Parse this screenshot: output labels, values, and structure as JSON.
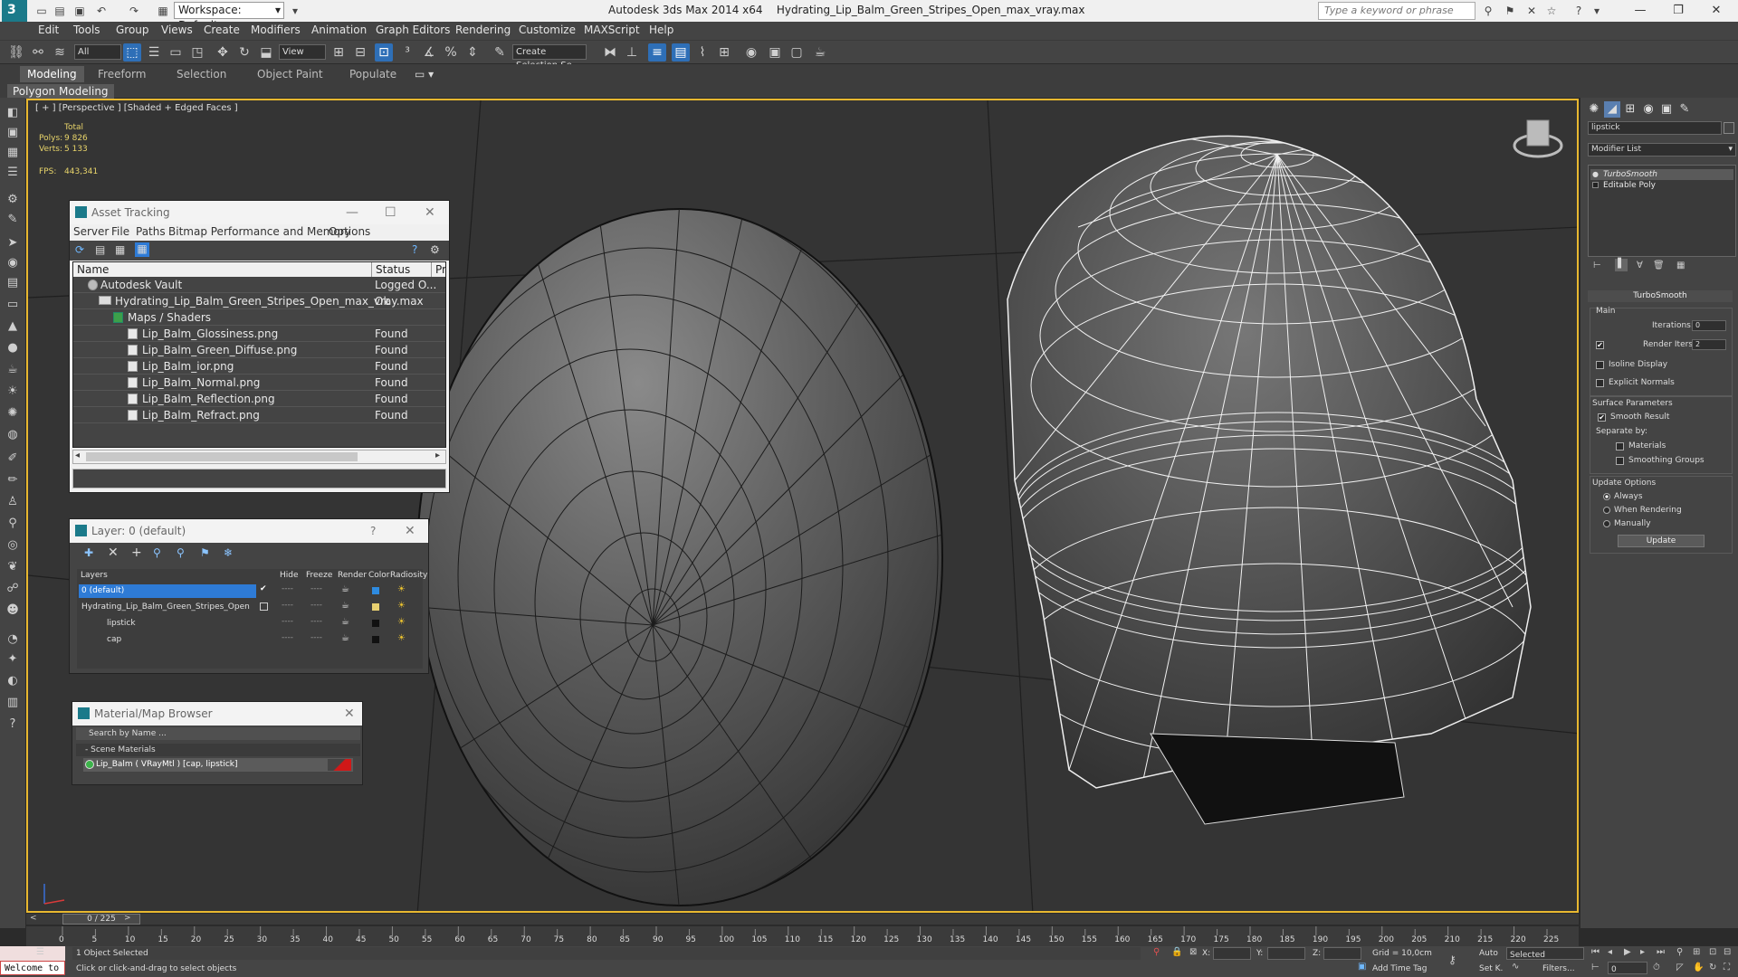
{
  "titlebar": {
    "workspace": "Workspace: Default",
    "app_title": "Autodesk 3ds Max  2014 x64",
    "file_title": "Hydrating_Lip_Balm_Green_Stripes_Open_max_vray.max",
    "search_placeholder": "Type a keyword or phrase"
  },
  "menu": [
    "Edit",
    "Tools",
    "Group",
    "Views",
    "Create",
    "Modifiers",
    "Animation",
    "Graph Editors",
    "Rendering",
    "Customize",
    "MAXScript",
    "Help"
  ],
  "toolbar": {
    "filter_value": "All",
    "refcoord_value": "View",
    "selection_set_placeholder": "Create Selection Se"
  },
  "ribbon": {
    "tabs": [
      "Modeling",
      "Freeform",
      "Selection",
      "Object Paint",
      "Populate"
    ],
    "active_tab": "Modeling",
    "panel_label": "Polygon Modeling"
  },
  "viewport": {
    "label": "[ + ] [Perspective ] [Shaded + Edged Faces ]",
    "stats_total": "Total",
    "stats_polys_label": "Polys:",
    "stats_polys": "9 826",
    "stats_verts_label": "Verts:",
    "stats_verts": "5 133",
    "fps_label": "FPS:",
    "fps": "443,341"
  },
  "asset_tracking": {
    "title": "Asset Tracking",
    "menu": [
      "Server",
      "File",
      "Paths",
      "Bitmap Performance and Memory",
      "Options"
    ],
    "col_name": "Name",
    "col_status": "Status",
    "col_pro": "Pro",
    "rows": [
      {
        "name": "Autodesk Vault",
        "status": "Logged O..."
      },
      {
        "name": "Hydrating_Lip_Balm_Green_Stripes_Open_max_vray.max",
        "status": "Ok"
      },
      {
        "name": "Maps / Shaders",
        "status": ""
      },
      {
        "name": "Lip_Balm_Glossiness.png",
        "status": "Found"
      },
      {
        "name": "Lip_Balm_Green_Diffuse.png",
        "status": "Found"
      },
      {
        "name": "Lip_Balm_ior.png",
        "status": "Found"
      },
      {
        "name": "Lip_Balm_Normal.png",
        "status": "Found"
      },
      {
        "name": "Lip_Balm_Reflection.png",
        "status": "Found"
      },
      {
        "name": "Lip_Balm_Refract.png",
        "status": "Found"
      }
    ]
  },
  "layer_explorer": {
    "title": "Layer: 0 (default)",
    "help": "?",
    "headers": [
      "Layers",
      "Hide",
      "Freeze",
      "Render",
      "Color",
      "Radiosity"
    ],
    "rows": [
      {
        "name": "0 (default)",
        "color": "#2e8be0"
      },
      {
        "name": "Hydrating_Lip_Balm_Green_Stripes_Open",
        "color": "#e8d070"
      },
      {
        "name": "lipstick",
        "color": "#111111"
      },
      {
        "name": "cap",
        "color": "#111111"
      }
    ],
    "dash": "----"
  },
  "material_browser": {
    "title": "Material/Map Browser",
    "search_placeholder": "Search by Name ...",
    "category": "- Scene Materials",
    "item": "Lip_Balm  ( VRayMtl ) [cap, lipstick]"
  },
  "command_panel": {
    "object_name": "lipstick",
    "modifier_list": "Modifier List",
    "stack": [
      "TurboSmooth",
      "Editable Poly"
    ],
    "rollout_title": "TurboSmooth",
    "main_label": "Main",
    "iterations_label": "Iterations:",
    "iterations_value": "0",
    "render_iters_label": "Render Iters:",
    "render_iters_value": "2",
    "isoline_label": "Isoline Display",
    "explicit_normals_label": "Explicit Normals",
    "surface_params_label": "Surface Parameters",
    "smooth_result_label": "Smooth Result",
    "separate_by_label": "Separate by:",
    "materials_label": "Materials",
    "smoothing_groups_label": "Smoothing Groups",
    "update_options_label": "Update Options",
    "always_label": "Always",
    "when_rendering_label": "When Rendering",
    "manually_label": "Manually",
    "update_button": "Update"
  },
  "timeline": {
    "frame_display": "0 / 225",
    "ticks": [
      "0",
      "5",
      "10",
      "15",
      "20",
      "25",
      "30",
      "35",
      "40",
      "45",
      "50",
      "55",
      "60",
      "65",
      "70",
      "75",
      "80",
      "85",
      "90",
      "95",
      "100",
      "105",
      "110",
      "115",
      "120",
      "125",
      "130",
      "135",
      "140",
      "145",
      "150",
      "155",
      "160",
      "165",
      "170",
      "175",
      "180",
      "185",
      "190",
      "195",
      "200",
      "205",
      "210",
      "215",
      "220",
      "225"
    ]
  },
  "statusbar": {
    "maxscript": "Welcome to",
    "selection_status": "1 Object Selected",
    "prompt": "Click or click-and-drag to select objects",
    "x_label": "X:",
    "y_label": "Y:",
    "z_label": "Z:",
    "grid": "Grid = 10,0cm",
    "add_time_tag": "Add Time Tag",
    "auto": "Auto",
    "selected": "Selected",
    "set_key": "Set K.",
    "filters": "Filters...",
    "frame": "0"
  }
}
